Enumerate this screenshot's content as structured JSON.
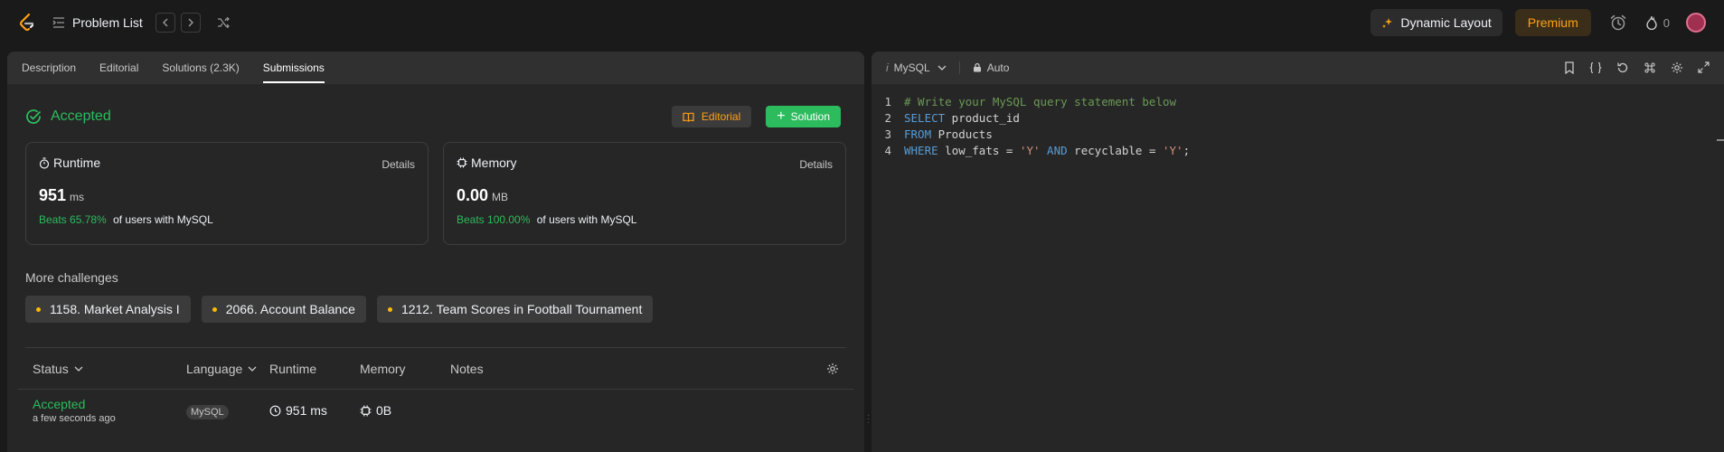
{
  "topnav": {
    "problem_list": "Problem List",
    "dynamic_layout": "Dynamic Layout",
    "premium": "Premium",
    "streak_count": "0"
  },
  "tabs": [
    {
      "label": "Description"
    },
    {
      "label": "Editorial"
    },
    {
      "label": "Solutions (2.3K)"
    },
    {
      "label": "Submissions"
    }
  ],
  "result": {
    "status": "Accepted",
    "editorial_btn": "Editorial",
    "solution_btn": "Solution"
  },
  "runtime": {
    "title": "Runtime",
    "details": "Details",
    "value": "951",
    "unit": "ms",
    "beats": "Beats 65.78%",
    "beats_suffix": "of users with MySQL"
  },
  "memory": {
    "title": "Memory",
    "details": "Details",
    "value": "0.00",
    "unit": "MB",
    "beats": "Beats 100.00%",
    "beats_suffix": "of users with MySQL"
  },
  "more_challenges": {
    "title": "More challenges",
    "items": [
      {
        "label": "1158. Market Analysis I"
      },
      {
        "label": "2066. Account Balance"
      },
      {
        "label": "1212. Team Scores in Football Tournament"
      }
    ]
  },
  "table": {
    "headers": {
      "status": "Status",
      "language": "Language",
      "runtime": "Runtime",
      "memory": "Memory",
      "notes": "Notes"
    },
    "rows": [
      {
        "status": "Accepted",
        "time": "a few seconds ago",
        "language": "MySQL",
        "runtime": "951 ms",
        "memory": "0B"
      }
    ]
  },
  "editor": {
    "language": "MySQL",
    "mode": "Auto",
    "lines": [
      {
        "num": "1",
        "comment": "# Write your MySQL query statement below"
      },
      {
        "num": "2",
        "kw": "SELECT",
        "rest": " product_id"
      },
      {
        "num": "3",
        "kw": "FROM",
        "rest": " Products"
      },
      {
        "num": "4",
        "kw": "WHERE",
        "a": " low_fats = ",
        "s1": "'Y'",
        "kw2": " AND",
        "b": " recyclable = ",
        "s2": "'Y'",
        "end": ";"
      }
    ]
  },
  "colors": {
    "accent_green": "#2cbb5d",
    "accent_orange": "#ffa116",
    "background": "#1a1a1a",
    "panel": "#262626"
  }
}
